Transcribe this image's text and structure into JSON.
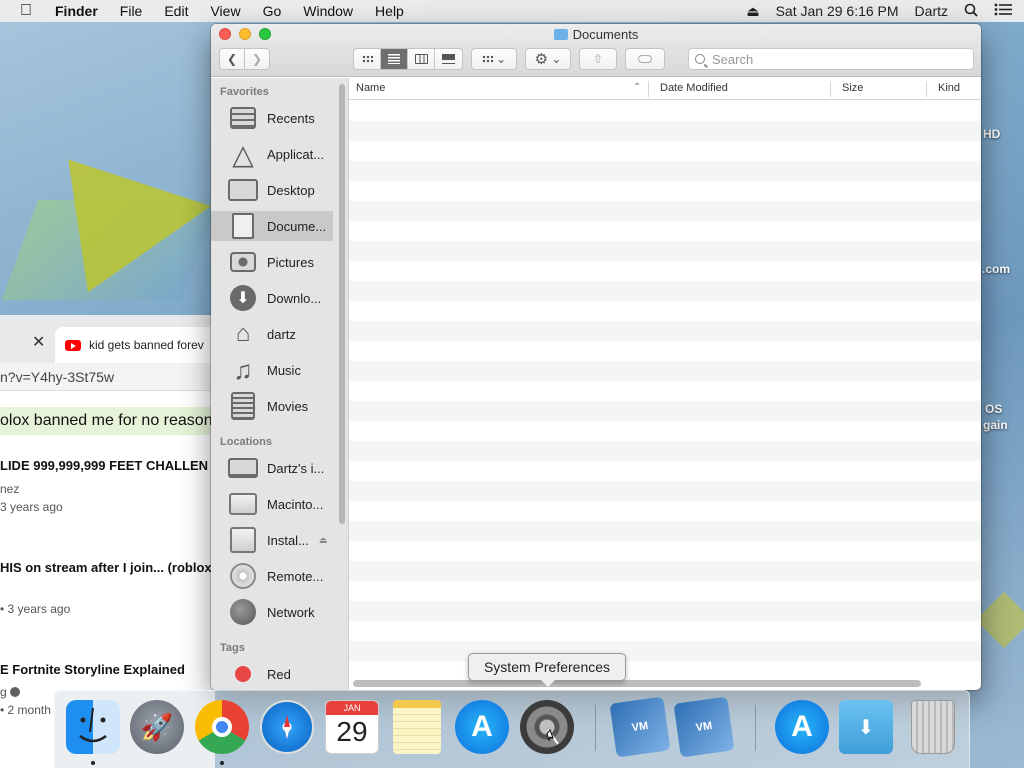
{
  "menubar": {
    "apple": "",
    "app": "Finder",
    "menus": [
      "File",
      "Edit",
      "View",
      "Go",
      "Window",
      "Help"
    ],
    "clock": "Sat Jan 29  6:16 PM",
    "user": "Dartz"
  },
  "desktop_labels": [
    "HD",
    ".com",
    "OS",
    "gain"
  ],
  "browser": {
    "tab_title": "kid gets banned forev",
    "url": "n?v=Y4hy-3St75w",
    "search_query": "olox banned me for no reason",
    "videos": [
      {
        "title": "LIDE 999,999,999 FEET CHALLEN",
        "meta1": "nez",
        "meta2": "3 years ago"
      },
      {
        "title": "HIS on stream after I join... (roblox",
        "meta1": "• 3 years ago",
        "meta2": ""
      },
      {
        "title": "E Fortnite Storyline Explained",
        "meta1": "g",
        "meta2": "• 2 month"
      }
    ]
  },
  "finder": {
    "title": "Documents",
    "search_placeholder": "Search",
    "sidebar": {
      "favorites_header": "Favorites",
      "favorites": [
        {
          "label": "Recents",
          "icon": "recents-icon"
        },
        {
          "label": "Applicat...",
          "icon": "applications-icon"
        },
        {
          "label": "Desktop",
          "icon": "desktop-icon"
        },
        {
          "label": "Docume...",
          "icon": "documents-icon",
          "selected": true
        },
        {
          "label": "Pictures",
          "icon": "camera-icon"
        },
        {
          "label": "Downlo...",
          "icon": "download-icon"
        },
        {
          "label": "dartz",
          "icon": "home-icon"
        },
        {
          "label": "Music",
          "icon": "music-icon"
        },
        {
          "label": "Movies",
          "icon": "film-icon"
        }
      ],
      "locations_header": "Locations",
      "locations": [
        {
          "label": "Dartz's i...",
          "icon": "computer-icon"
        },
        {
          "label": "Macinto...",
          "icon": "hard-drive-icon"
        },
        {
          "label": "Instal...",
          "icon": "external-drive-icon",
          "eject": "⏏"
        },
        {
          "label": "Remote...",
          "icon": "disc-icon"
        },
        {
          "label": "Network",
          "icon": "network-icon"
        }
      ],
      "tags_header": "Tags",
      "tags": [
        {
          "label": "Red",
          "color": "#e84545"
        }
      ]
    },
    "columns": [
      "Name",
      "Date Modified",
      "Size",
      "Kind"
    ]
  },
  "dock": {
    "tooltip": "System Preferences",
    "calendar_month": "JAN",
    "calendar_day": "29"
  }
}
